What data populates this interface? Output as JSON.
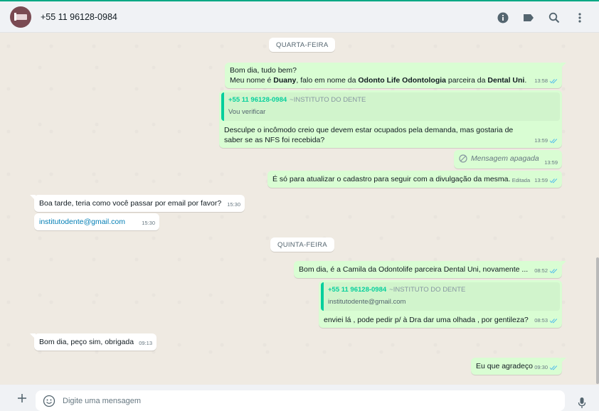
{
  "header": {
    "contact_name": "+55 11 96128-0984",
    "icons": [
      "info-icon",
      "label-icon",
      "search-icon",
      "menu-icon"
    ]
  },
  "days": {
    "wednesday": "QUARTA-FEIRA",
    "thursday": "QUINTA-FEIRA"
  },
  "messages": {
    "m1": {
      "line1": "Bom dia, tudo bem?",
      "line2_pre": "Meu nome é ",
      "name": "Duany",
      "line2_mid": ", falo em nome da ",
      "company": "Odonto Life Odontologia",
      "line2_mid2": " parceira da ",
      "partner": "Dental Uni",
      "line2_end": ".",
      "time": "13:58"
    },
    "m2": {
      "quote_author": "+55 11 96128-0984",
      "quote_alias": "~INSTITUTO DO DENTE",
      "quote_text": "Vou verificar",
      "text": "Desculpe o incômodo creio que devem estar ocupados pela demanda, mas gostaria de saber se as NFS foi recebida?",
      "time": "13:59"
    },
    "m3": {
      "text": "Mensagem apagada",
      "time": "13:59"
    },
    "m4": {
      "text": "É só para atualizar o cadastro para seguir com a divulgação da mesma.",
      "edited": "Editada",
      "time": "13:59"
    },
    "m5": {
      "text": "Boa tarde, teria como você passar por email por favor?",
      "time": "15:30"
    },
    "m6": {
      "text": "institutodente@gmail.com",
      "time": "15:30"
    },
    "m7": {
      "text": "Bom dia, é a Camila da Odontolife parceira Dental Uni, novamente ...",
      "time": "08:52"
    },
    "m8": {
      "quote_author": "+55 11 96128-0984",
      "quote_alias": "~INSTITUTO DO DENTE",
      "quote_text": "institutodente@gmail.com",
      "text": "enviei lá , pode pedir p/ à Dra dar uma olhada , por gentileza?",
      "time": "08:53"
    },
    "m9": {
      "text": "Bom dia, peço sim, obrigada",
      "time": "09:13"
    },
    "m10": {
      "text": "Eu que agradeço",
      "time": "09:30"
    }
  },
  "composer": {
    "placeholder": "Digite uma mensagem"
  },
  "colors": {
    "accent": "#00a884",
    "outgoing_bubble": "#d9fdd3",
    "incoming_bubble": "#ffffff",
    "read_tick": "#53bdeb",
    "quote_author": "#06cf9c"
  }
}
